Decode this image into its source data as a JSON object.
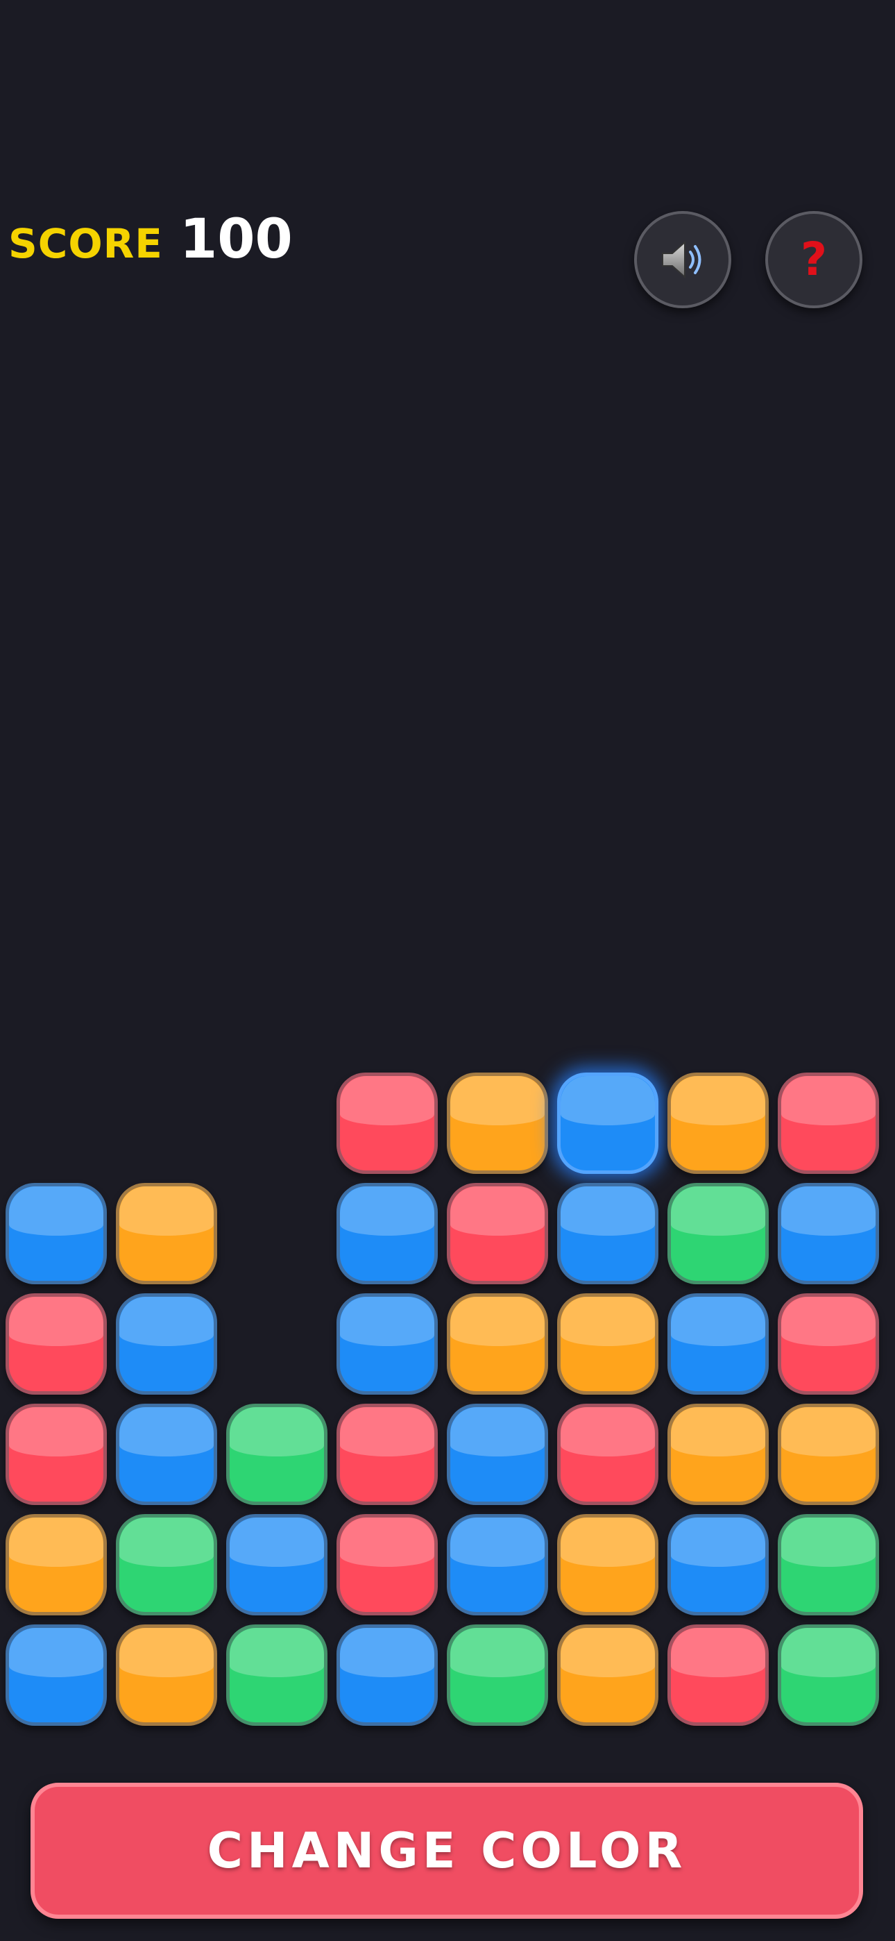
{
  "header": {
    "score_label": "SCORE",
    "score_value": "100",
    "sound_icon": "speaker-icon",
    "help_label": "?"
  },
  "colors": {
    "background": "#1b1b24",
    "red": "#ff4a5c",
    "orange": "#ffa41c",
    "blue": "#1e8cf7",
    "green": "#2ed573",
    "score_label": "#f5d300",
    "button": "#f04d62"
  },
  "board": {
    "columns": 8,
    "rows": 6,
    "selected_cell": [
      0,
      5
    ],
    "grid": [
      [
        null,
        null,
        null,
        "red",
        "orange",
        "blue",
        "orange",
        "red"
      ],
      [
        "blue",
        "orange",
        null,
        "blue",
        "red",
        "blue",
        "green",
        "blue"
      ],
      [
        "red",
        "blue",
        null,
        "blue",
        "orange",
        "orange",
        "blue",
        "red"
      ],
      [
        "red",
        "blue",
        "green",
        "red",
        "blue",
        "red",
        "orange",
        "orange"
      ],
      [
        "orange",
        "green",
        "blue",
        "red",
        "blue",
        "orange",
        "blue",
        "green"
      ],
      [
        "blue",
        "orange",
        "green",
        "blue",
        "green",
        "orange",
        "red",
        "green"
      ]
    ]
  },
  "actions": {
    "change_color_label": "CHANGE COLOR"
  }
}
